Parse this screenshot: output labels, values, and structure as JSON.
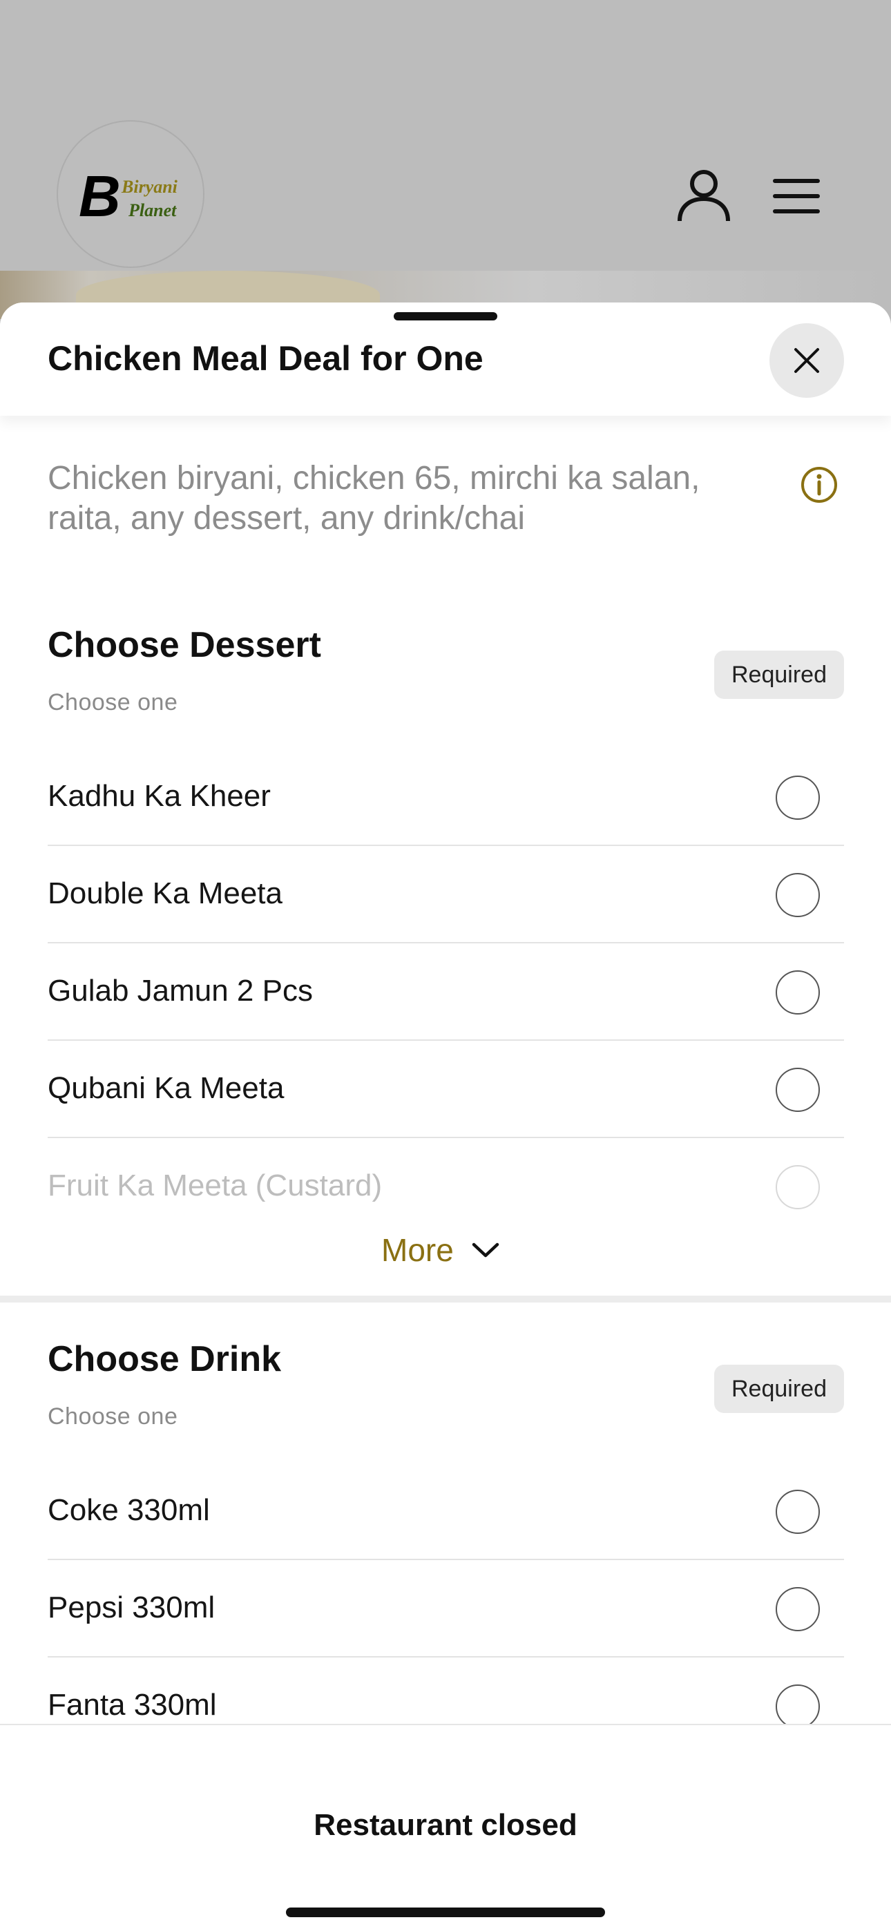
{
  "brand": {
    "logo_letter": "B",
    "logo_line1": "Biryani",
    "logo_line2": "Planet"
  },
  "header_icons": [
    "user-icon",
    "menu-icon"
  ],
  "sheet": {
    "title": "Chicken Meal Deal for One",
    "close_icon": "close-icon",
    "description": "Chicken biryani, chicken 65, mirchi ka salan, raita, any dessert, any drink/chai",
    "info_icon": "info-icon"
  },
  "dessert": {
    "title": "Choose Dessert",
    "subtitle": "Choose one",
    "badge": "Required",
    "options": [
      {
        "label": "Kadhu Ka Kheer"
      },
      {
        "label": "Double Ka Meeta"
      },
      {
        "label": "Gulab Jamun 2 Pcs"
      },
      {
        "label": "Qubani Ka Meeta"
      },
      {
        "label": "Fruit Ka Meeta (Custard)"
      }
    ],
    "more_label": "More"
  },
  "drink": {
    "title": "Choose Drink",
    "subtitle": "Choose one",
    "badge": "Required",
    "options": [
      {
        "label": "Coke 330ml"
      },
      {
        "label": "Pepsi 330ml"
      },
      {
        "label": "Fanta 330ml"
      }
    ]
  },
  "footer": {
    "status": "Restaurant closed"
  },
  "colors": {
    "accent": "#8a7012",
    "overlay": "#bcbcbc",
    "badge_bg": "#e9e9e9"
  }
}
